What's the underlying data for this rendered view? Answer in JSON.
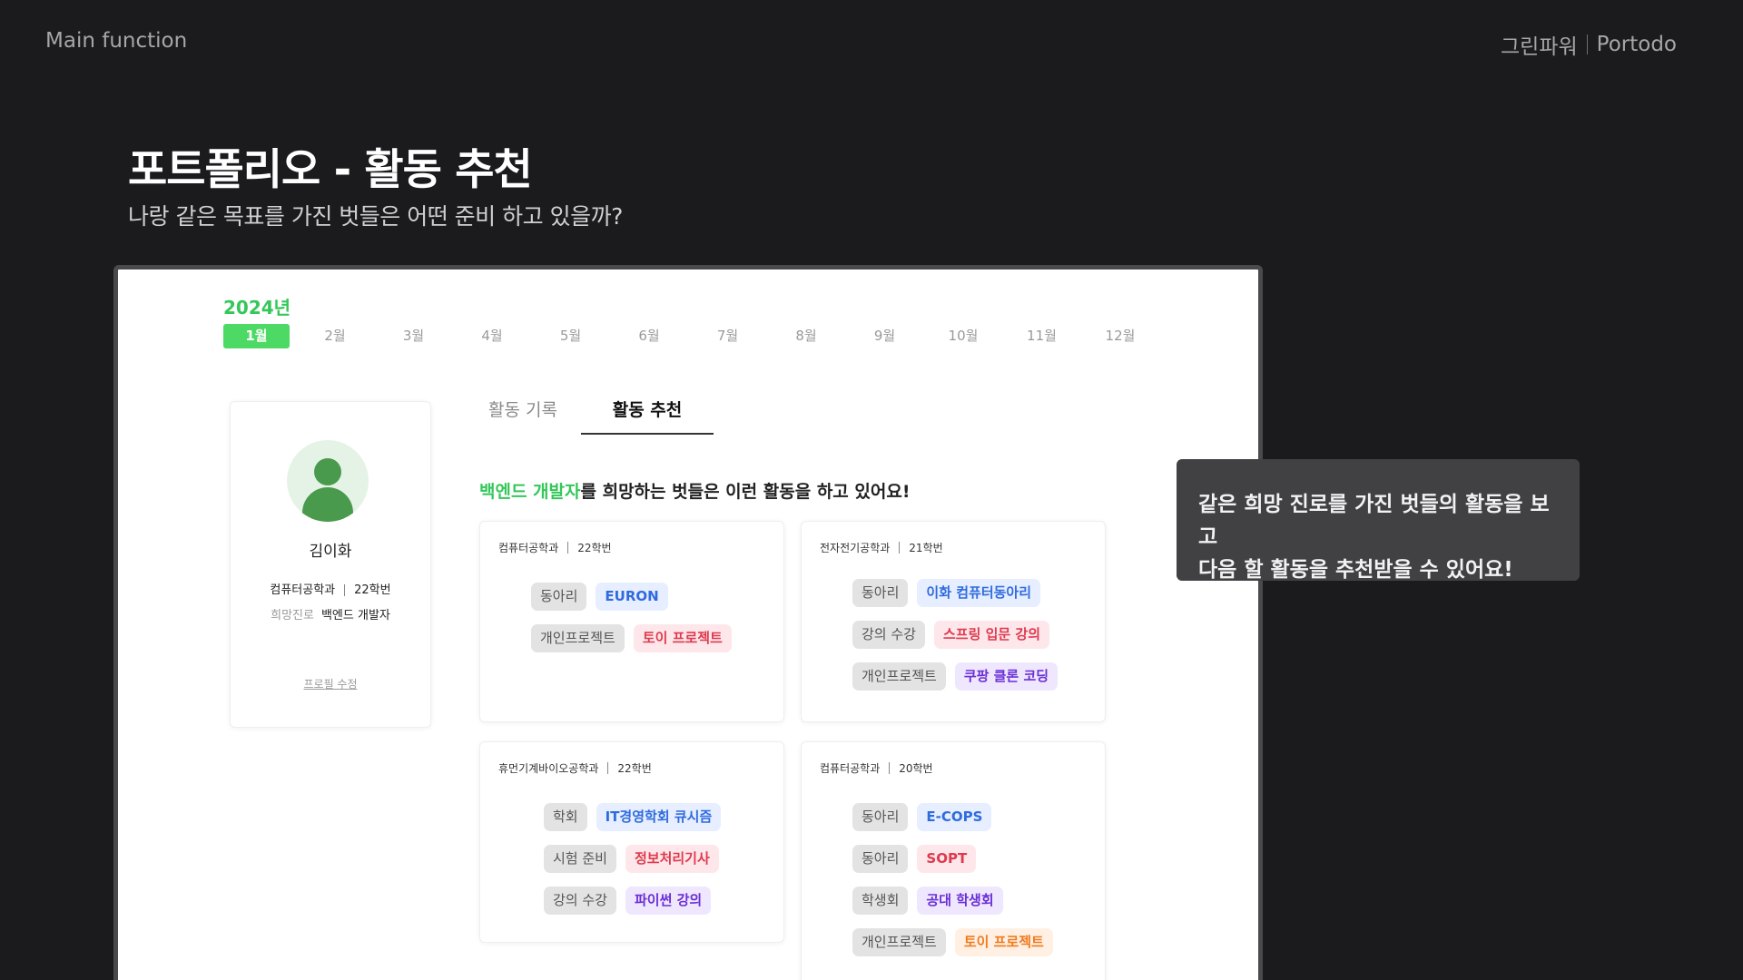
{
  "header": {
    "section": "Main function",
    "team": "그린파워",
    "product": "Portodo"
  },
  "hero": {
    "title": "포트폴리오 - 활동 추천",
    "subtitle": "나랑 같은 목표를 가진 벗들은 어떤 준비 하고 있을까?"
  },
  "calendar": {
    "year": "2024년",
    "months": [
      "1월",
      "2월",
      "3월",
      "4월",
      "5월",
      "6월",
      "7월",
      "8월",
      "9월",
      "10월",
      "11월",
      "12월"
    ],
    "selected": "1월"
  },
  "profile": {
    "name": "김이화",
    "department": "컴퓨터공학과",
    "class_year": "22학번",
    "goal_label": "희망진로",
    "goal": "백엔드 개발자",
    "edit_label": "프로필 수정",
    "avatar_icon": "user-avatar-icon"
  },
  "tabs": [
    {
      "label": "활동 기록",
      "active": false
    },
    {
      "label": "활동 추천",
      "active": true
    }
  ],
  "recommendation": {
    "highlight": "백엔드 개발자",
    "heading_rest": "를 희망하는 벗들은 이런 활동을 하고 있어요!",
    "cards": [
      {
        "department": "컴퓨터공학과",
        "class_year": "22학번",
        "rows": [
          {
            "category": "동아리",
            "activity": "EURON",
            "color": "blue"
          },
          {
            "category": "개인프로젝트",
            "activity": "토이 프로젝트",
            "color": "red"
          }
        ]
      },
      {
        "department": "전자전기공학과",
        "class_year": "21학번",
        "rows": [
          {
            "category": "동아리",
            "activity": "이화 컴퓨터동아리",
            "color": "blue"
          },
          {
            "category": "강의 수강",
            "activity": "스프링 입문 강의",
            "color": "red"
          },
          {
            "category": "개인프로젝트",
            "activity": "쿠팡 클론 코딩",
            "color": "purple"
          }
        ]
      },
      {
        "department": "휴먼기계바이오공학과",
        "class_year": "22학번",
        "rows": [
          {
            "category": "학회",
            "activity": "IT경영학회 큐시즘",
            "color": "blue"
          },
          {
            "category": "시험 준비",
            "activity": "정보처리기사",
            "color": "red"
          },
          {
            "category": "강의 수강",
            "activity": "파이썬 강의",
            "color": "purple"
          }
        ]
      },
      {
        "department": "컴퓨터공학과",
        "class_year": "20학번",
        "rows": [
          {
            "category": "동아리",
            "activity": "E-COPS",
            "color": "blue"
          },
          {
            "category": "동아리",
            "activity": "SOPT",
            "color": "red"
          },
          {
            "category": "학생회",
            "activity": "공대 학생회",
            "color": "purple"
          },
          {
            "category": "개인프로젝트",
            "activity": "토이 프로젝트",
            "color": "orange"
          }
        ]
      }
    ]
  },
  "tooltip": {
    "line1": "같은 희망 진로를 가진 벗들의 활동을 보고",
    "line2": "다음 할 활동을 추천받을 수 있어요!"
  },
  "colors": {
    "background": "#1b1b1d",
    "accent_green": "#34c759",
    "month_active": "#4cd964",
    "tooltip_bg": "#414144"
  }
}
